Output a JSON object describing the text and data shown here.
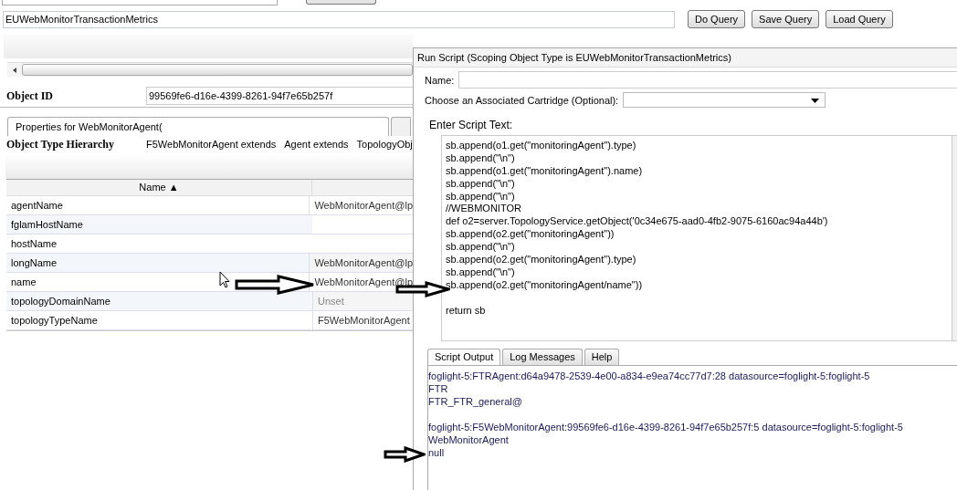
{
  "query": {
    "value": "EUWebMonitorTransactionMetrics",
    "buttons": [
      "Do Query",
      "Save Query",
      "Load Query"
    ]
  },
  "object_id": {
    "label": "Object ID",
    "value": "99569fe6-d16e-4399-8261-94f7e65b257f"
  },
  "tabs": [
    {
      "label": "Properties for WebMonitorAgent(",
      "selected": true
    }
  ],
  "hierarchy": {
    "label": "Object Type Hierarchy",
    "items": [
      "F5WebMonitorAgent extends",
      "Agent extends",
      "TopologyObj"
    ]
  },
  "table": {
    "columns": [
      "Name ▲"
    ],
    "rows": [
      {
        "name": "agentName",
        "value": "WebMonitorAgent@lp",
        "unset": false
      },
      {
        "name": "fglamHostName"
      },
      {
        "name": "hostName"
      },
      {
        "name": "longName",
        "value": "WebMonitorAgent@lp",
        "unset": false
      },
      {
        "name": "name",
        "value": "WebMonitorAgent@lp",
        "unset": false
      },
      {
        "name": "topologyDomainName",
        "value": "Unset",
        "unset": true
      },
      {
        "name": "topologyTypeName",
        "value": "F5WebMonitorAgent",
        "unset": false
      }
    ]
  },
  "dialog": {
    "title": "Run Script (Scoping Object Type is EUWebMonitorTransactionMetrics)",
    "name_label": "Name:",
    "cartridge_label": "Choose an Associated Cartridge (Optional):",
    "script_label": "Enter Script Text:",
    "script_lines": [
      "sb.append(o1.get(\"monitoringAgent\").type)",
      "sb.append(\"\\n\")",
      "sb.append(o1.get(\"monitoringAgent\").name)",
      "sb.append(\"\\n\")",
      "sb.append(\"\\n\")",
      "//WEBMONITOR",
      "def o2=server.TopologyService.getObject('0c34e675-aad0-4fb2-9075-6160ac94a44b')",
      "sb.append(o2.get(\"monitoringAgent\"))",
      "sb.append(\"\\n\")",
      "sb.append(o2.get(\"monitoringAgent\").type)",
      "sb.append(\"\\n\")",
      "sb.append(o2.get(\"monitoringAgent/name\"))"
    ],
    "script_return": "return sb",
    "output_tabs": [
      {
        "label": "Script Output",
        "selected": true
      },
      {
        "label": "Log Messages",
        "selected": false
      },
      {
        "label": "Help",
        "selected": false
      }
    ],
    "output_blocks": [
      {
        "lines": [
          "foglight-5:FTRAgent:d64a9478-2539-4e00-a834-e9ea74cc77d7:28 datasource=foglight-5:foglight-5",
          "FTR",
          "FTR_FTR_general@"
        ]
      },
      {
        "lines": [
          "foglight-5:F5WebMonitorAgent:99569fe6-d16e-4399-8261-94f7e65b257f:5 datasource=foglight-5:foglight-5",
          "WebMonitorAgent",
          "null"
        ]
      }
    ]
  }
}
